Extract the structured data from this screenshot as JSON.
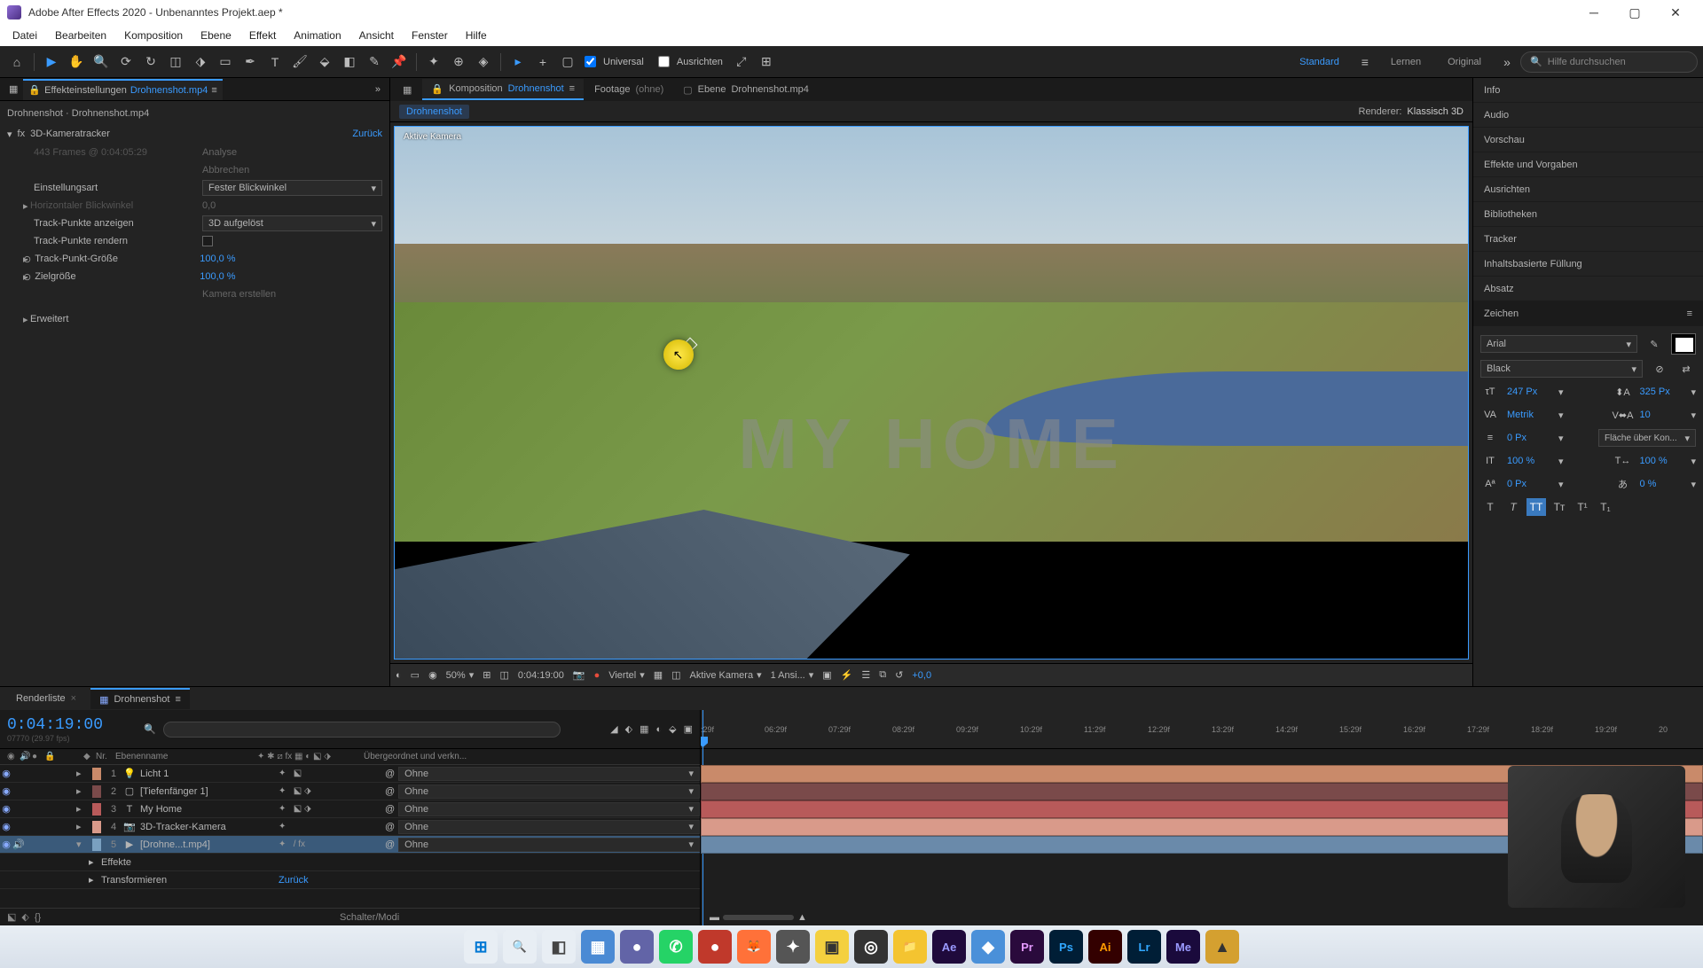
{
  "titlebar": {
    "app": "Adobe After Effects 2020 - Unbenanntes Projekt.aep *"
  },
  "menu": [
    "Datei",
    "Bearbeiten",
    "Komposition",
    "Ebene",
    "Effekt",
    "Animation",
    "Ansicht",
    "Fenster",
    "Hilfe"
  ],
  "toolbar": {
    "snapping": "Universal",
    "align": "Ausrichten",
    "workspaces": {
      "active": "Standard",
      "others": [
        "Lernen",
        "Original"
      ]
    },
    "search_placeholder": "Hilfe durchsuchen"
  },
  "effect_panel": {
    "tab_label": "Effekteinstellungen",
    "tab_source": "Drohnenshot.mp4",
    "crumb": "Drohnenshot · Drohnenshot.mp4",
    "fx_name": "3D-Kameratracker",
    "reset": "Zurück",
    "status1": "443 Frames @ 0:04:05:29",
    "analyse": "Analyse",
    "cancel": "Abbrechen",
    "rows": {
      "einstellung_lbl": "Einstellungsart",
      "einstellung_val": "Fester Blickwinkel",
      "horiz_lbl": "Horizontaler Blickwinkel",
      "horiz_val": "0,0",
      "tp_anz_lbl": "Track-Punkte anzeigen",
      "tp_anz_val": "3D aufgelöst",
      "tp_ren_lbl": "Track-Punkte rendern",
      "tpg_lbl": "Track-Punkt-Größe",
      "tpg_val": "100,0 %",
      "zg_lbl": "Zielgröße",
      "zg_val": "100,0 %",
      "kamera": "Kamera erstellen",
      "erw_lbl": "Erweitert"
    }
  },
  "comp_tabs": {
    "comp_label": "Komposition",
    "comp_name": "Drohnenshot",
    "footage_label": "Footage",
    "footage_name": "(ohne)",
    "layer_label": "Ebene",
    "layer_name": "Drohnenshot.mp4"
  },
  "breadcrumb": {
    "name": "Drohnenshot",
    "renderer_lbl": "Renderer:",
    "renderer_val": "Klassisch 3D"
  },
  "viewport": {
    "corner": "Aktive Kamera",
    "overlay_text": "MY HOME",
    "footer": {
      "zoom": "50%",
      "tc": "0:04:19:00",
      "res": "Viertel",
      "cam": "Aktive Kamera",
      "views": "1 Ansi...",
      "exp": "+0,0"
    }
  },
  "right_panel": {
    "tabs": [
      "Info",
      "Audio",
      "Vorschau",
      "Effekte und Vorgaben",
      "Ausrichten",
      "Bibliotheken",
      "Tracker",
      "Inhaltsbasierte Füllung",
      "Absatz"
    ],
    "char_title": "Zeichen",
    "font": "Arial",
    "weight": "Black",
    "size": "247 Px",
    "leading": "325 Px",
    "kerning": "Metrik",
    "tracking": "10",
    "stroke": "0 Px",
    "stroke_opt": "Fläche über Kon...",
    "vscale": "100 %",
    "hscale": "100 %",
    "baseline": "0 Px",
    "tsume": "0 %"
  },
  "timeline": {
    "tabs": {
      "render": "Renderliste",
      "comp": "Drohnenshot"
    },
    "timecode": "0:04:19:00",
    "sub_tc": "07770 (29.97 fps)",
    "col_num": "Nr.",
    "col_name": "Ebenenname",
    "col_parent": "Übergeordnet und verkn...",
    "parent_none": "Ohne",
    "layers": [
      {
        "n": "1",
        "name": "Licht 1",
        "color": "#c98a6a",
        "icon": "💡"
      },
      {
        "n": "2",
        "name": "[Tiefenfänger 1]",
        "color": "#7a4a4a",
        "icon": "▢"
      },
      {
        "n": "3",
        "name": "My Home",
        "color": "#b85a5a",
        "icon": "T"
      },
      {
        "n": "4",
        "name": "3D-Tracker-Kamera",
        "color": "#d99a8a",
        "icon": "📷"
      },
      {
        "n": "5",
        "name": "[Drohne...t.mp4]",
        "color": "#7aa0c0",
        "icon": "▶",
        "sel": true
      }
    ],
    "sub_effects": "Effekte",
    "sub_transform": "Transformieren",
    "sub_reset": "Zurück",
    "footer": "Schalter/Modi",
    "ruler_ticks": [
      ":29f",
      "06:29f",
      "07:29f",
      "08:29f",
      "09:29f",
      "10:29f",
      "11:29f",
      "12:29f",
      "13:29f",
      "14:29f",
      "15:29f",
      "16:29f",
      "17:29f",
      "18:29f",
      "19:29f",
      "20"
    ]
  },
  "taskbar": [
    {
      "name": "start",
      "bg": "#e8eef4",
      "txt": "⊞",
      "color": "#0078d4"
    },
    {
      "name": "search",
      "bg": "#e8eef4",
      "txt": "🔍",
      "color": "#444"
    },
    {
      "name": "taskview",
      "bg": "#e8eef4",
      "txt": "◧",
      "color": "#444"
    },
    {
      "name": "explorer",
      "bg": "#4a8ad4",
      "txt": "▦",
      "color": "#fff"
    },
    {
      "name": "teams",
      "bg": "#6264a7",
      "txt": "●",
      "color": "#fff"
    },
    {
      "name": "whatsapp",
      "bg": "#25d366",
      "txt": "✆",
      "color": "#fff"
    },
    {
      "name": "app1",
      "bg": "#c0392b",
      "txt": "●",
      "color": "#fff"
    },
    {
      "name": "firefox",
      "bg": "#ff7139",
      "txt": "🦊",
      "color": "#fff"
    },
    {
      "name": "app2",
      "bg": "#555",
      "txt": "✦",
      "color": "#fff"
    },
    {
      "name": "notes",
      "bg": "#f4d03f",
      "txt": "▣",
      "color": "#333"
    },
    {
      "name": "obs",
      "bg": "#333",
      "txt": "◎",
      "color": "#fff"
    },
    {
      "name": "files",
      "bg": "#f4c430",
      "txt": "📁",
      "color": "#333"
    },
    {
      "name": "ae",
      "bg": "#1f0a3c",
      "txt": "Ae",
      "color": "#9a9aff"
    },
    {
      "name": "app3",
      "bg": "#4a90d9",
      "txt": "◆",
      "color": "#fff"
    },
    {
      "name": "pr",
      "bg": "#2a0a3c",
      "txt": "Pr",
      "color": "#e49aff"
    },
    {
      "name": "ps",
      "bg": "#001e36",
      "txt": "Ps",
      "color": "#31a8ff"
    },
    {
      "name": "ai",
      "bg": "#330000",
      "txt": "Ai",
      "color": "#ff9a00"
    },
    {
      "name": "lr",
      "bg": "#001e36",
      "txt": "Lr",
      "color": "#31a8ff"
    },
    {
      "name": "me",
      "bg": "#1a0a3c",
      "txt": "Me",
      "color": "#9a9aff"
    },
    {
      "name": "app4",
      "bg": "#d4a030",
      "txt": "▲",
      "color": "#333"
    }
  ]
}
